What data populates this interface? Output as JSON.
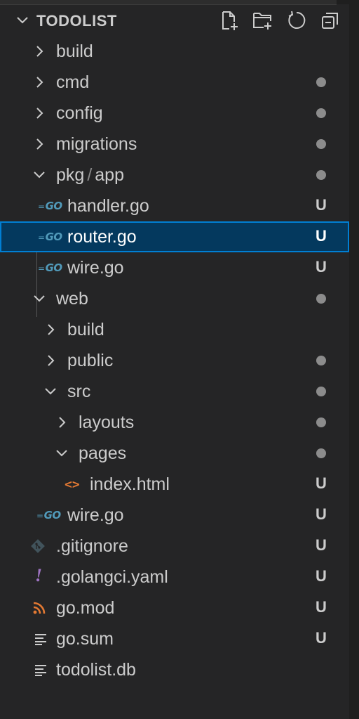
{
  "explorer": {
    "title": "TODOLIST",
    "toolbar": [
      "new-file-icon",
      "new-folder-icon",
      "refresh-icon",
      "collapse-all-icon"
    ]
  },
  "tree": [
    {
      "label": "build"
    },
    {
      "label": "cmd"
    },
    {
      "label": "config"
    },
    {
      "label": "migrations"
    },
    {
      "label_a": "pkg",
      "label_sep": "/",
      "label_b": "app"
    },
    {
      "label": "handler.go",
      "status": "U"
    },
    {
      "label": "router.go",
      "status": "U"
    },
    {
      "label": "wire.go",
      "status": "U"
    },
    {
      "label": "web"
    },
    {
      "label": "build"
    },
    {
      "label": "public"
    },
    {
      "label": "src"
    },
    {
      "label": "layouts"
    },
    {
      "label": "pages"
    },
    {
      "label": "index.html",
      "status": "U"
    },
    {
      "label": "wire.go",
      "status": "U"
    },
    {
      "label": ".gitignore",
      "status": "U"
    },
    {
      "label": ".golangci.yaml",
      "status": "U"
    },
    {
      "label": "go.mod",
      "status": "U"
    },
    {
      "label": "go.sum",
      "status": "U"
    },
    {
      "label": "todolist.db"
    }
  ],
  "icons": {
    "go_text": "GO",
    "html_text": "<>",
    "yaml_text": "!"
  },
  "colors": {
    "background": "#252526",
    "selection": "#04395e",
    "selection_border": "#007fd4",
    "go": "#519aba",
    "html": "#e37933",
    "yaml": "#a074c4",
    "rss": "#e37933"
  }
}
